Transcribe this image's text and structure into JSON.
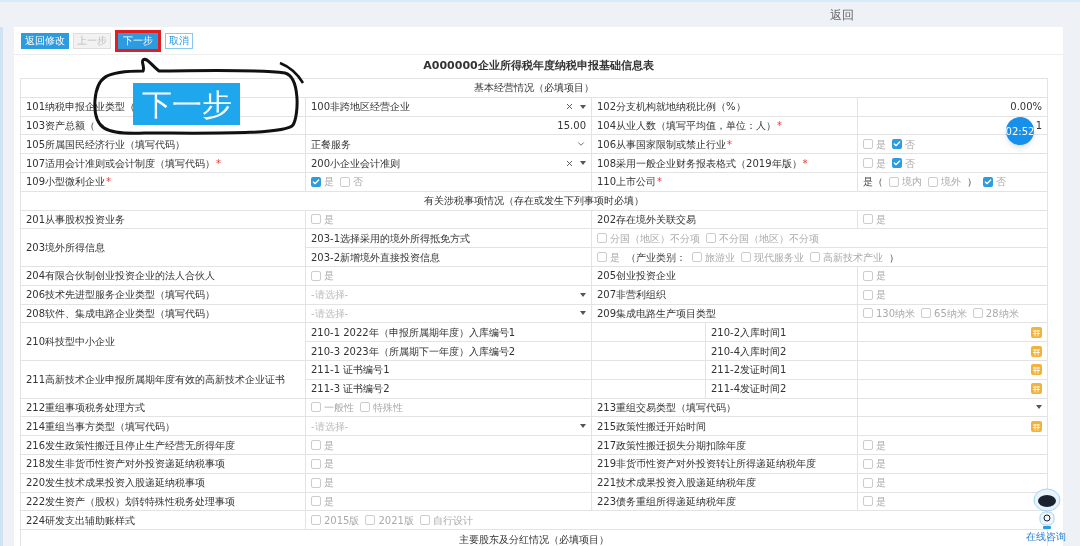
{
  "top_bar": {
    "link": "返回"
  },
  "toolbar": {
    "buttons": [
      {
        "label": "返回修改",
        "kind": "primary",
        "highlighted": false
      },
      {
        "label": "上一步",
        "kind": "disabled",
        "highlighted": false
      },
      {
        "label": "下一步",
        "kind": "primary",
        "highlighted": true
      },
      {
        "label": "取消",
        "kind": "outline",
        "highlighted": false
      }
    ]
  },
  "callout": {
    "text": "下一步"
  },
  "form": {
    "title": "A000000企业所得税年度纳税申报基础信息表",
    "sections": [
      {
        "title": "基本经营情况（必填项目）",
        "rows": [
          {
            "kind": "pair",
            "label": "101纳税申报企业类型（",
            "value": {
              "kind": "select",
              "value": "100非跨地区经营企业",
              "clearable": true
            },
            "right_label": "102分支机构就地纳税比例（%）",
            "right_value": {
              "kind": "number",
              "value": "0.00%"
            }
          },
          {
            "kind": "pair",
            "label": "103资产总额（",
            "value": {
              "kind": "number",
              "value": "15.00"
            },
            "right_label": "104从业人数（填写平均值，单位：人）",
            "right_mark": "*",
            "right_value": {
              "kind": "number",
              "value": "1"
            }
          },
          {
            "kind": "pair",
            "label": "105所属国民经济行业（填写代码）",
            "value": {
              "kind": "select",
              "value": "正餐服务",
              "clearable": false,
              "chevron": true
            },
            "right_label": "106从事国家限制或禁止行业",
            "right_mark": "*",
            "right_value": {
              "kind": "checks",
              "items": [
                {
                  "kind": "check",
                  "label": "是",
                  "checked": false
                },
                {
                  "kind": "check",
                  "label": "否",
                  "checked": true
                }
              ]
            }
          },
          {
            "kind": "pair",
            "label": "107适用会计准则或会计制度（填写代码）",
            "mark": "*",
            "value": {
              "kind": "select",
              "value": "200小企业会计准则",
              "clearable": true
            },
            "right_label": "108采用一般企业财务报表格式（2019年版）",
            "right_mark": "*",
            "right_value": {
              "kind": "checks",
              "items": [
                {
                  "kind": "check",
                  "label": "是",
                  "checked": false
                },
                {
                  "kind": "check",
                  "label": "否",
                  "checked": true
                }
              ]
            }
          },
          {
            "kind": "pair",
            "label": "109小型微利企业",
            "mark": "*",
            "value": {
              "kind": "checks",
              "items": [
                {
                  "kind": "check",
                  "label": "是",
                  "checked": true
                },
                {
                  "kind": "check",
                  "label": "否",
                  "checked": false
                }
              ]
            },
            "right_label": "110上市公司",
            "right_mark": "*",
            "right_value": {
              "kind": "checks",
              "items": [
                {
                  "kind": "text",
                  "text": "是（"
                },
                {
                  "kind": "check",
                  "label": "境内",
                  "checked": false
                },
                {
                  "kind": "check",
                  "label": "境外",
                  "checked": false
                },
                {
                  "kind": "text",
                  "text": "）"
                },
                {
                  "kind": "check",
                  "label": "否",
                  "checked": true
                }
              ]
            }
          }
        ]
      },
      {
        "title": "有关涉税事项情况（存在或发生下列事项时必填）",
        "rows": [
          {
            "kind": "pair",
            "label": "201从事股权投资业务",
            "value": {
              "kind": "checks",
              "items": [
                {
                  "kind": "check",
                  "label": "是",
                  "checked": false
                }
              ]
            },
            "right_label": "202存在境外关联交易",
            "right_value": {
              "kind": "checks",
              "items": [
                {
                  "kind": "check",
                  "label": "是",
                  "checked": false
                }
              ]
            }
          },
          {
            "kind": "group",
            "label": "203境外所得信息",
            "subrows": [
              {
                "label": "203-1选择采用的境外所得抵免方式",
                "value": {
                  "kind": "checks",
                  "items": [
                    {
                      "kind": "check",
                      "label": "分国（地区）不分项",
                      "checked": false
                    },
                    {
                      "kind": "check",
                      "label": "不分国（地区）不分项",
                      "checked": false
                    }
                  ]
                }
              },
              {
                "label": "203-2新增境外直接投资信息",
                "value": {
                  "kind": "checks",
                  "items": [
                    {
                      "kind": "check",
                      "label": "是",
                      "checked": false
                    },
                    {
                      "kind": "text",
                      "text": "（产业类别："
                    },
                    {
                      "kind": "check",
                      "label": "旅游业",
                      "checked": false
                    },
                    {
                      "kind": "check",
                      "label": "现代服务业",
                      "checked": false
                    },
                    {
                      "kind": "check",
                      "label": "高新技术产业",
                      "checked": false
                    },
                    {
                      "kind": "text",
                      "text": "）"
                    }
                  ]
                }
              }
            ]
          },
          {
            "kind": "pair",
            "label": "204有限合伙制创业投资企业的法人合伙人",
            "value": {
              "kind": "checks",
              "items": [
                {
                  "kind": "check",
                  "label": "是",
                  "checked": false
                }
              ]
            },
            "right_label": "205创业投资企业",
            "right_value": {
              "kind": "checks",
              "items": [
                {
                  "kind": "check",
                  "label": "是",
                  "checked": false
                }
              ]
            }
          },
          {
            "kind": "pair",
            "label": "206技术先进型服务企业类型（填写代码）",
            "value": {
              "kind": "select",
              "placeholder": "-请选择-",
              "clearable": false
            },
            "right_label": "207非营利组织",
            "right_value": {
              "kind": "checks",
              "items": [
                {
                  "kind": "check",
                  "label": "是",
                  "checked": false
                }
              ]
            }
          },
          {
            "kind": "pair",
            "label": "208软件、集成电路企业类型（填写代码）",
            "value": {
              "kind": "select",
              "placeholder": "-请选择-",
              "clearable": false
            },
            "right_label": "209集成电路生产项目类型",
            "right_value": {
              "kind": "checks",
              "items": [
                {
                  "kind": "check",
                  "label": "130纳米",
                  "checked": false
                },
                {
                  "kind": "check",
                  "label": "65纳米",
                  "checked": false
                },
                {
                  "kind": "check",
                  "label": "28纳米",
                  "checked": false
                }
              ]
            }
          },
          {
            "kind": "group",
            "label": "210科技型中小企业",
            "subrows": [
              {
                "label": "210-1 2022年（申报所属期年度）入库编号1",
                "right_label": "210-2入库时间1",
                "right_value": {
                  "kind": "date"
                }
              },
              {
                "label": "210-3 2023年（所属期下一年度）入库编号2",
                "right_label": "210-4入库时间2",
                "right_value": {
                  "kind": "date"
                }
              }
            ]
          },
          {
            "kind": "group",
            "label": "211高新技术企业申报所属期年度有效的高新技术企业证书",
            "subrows": [
              {
                "label": "211-1 证书编号1",
                "right_label": "211-2发证时间1",
                "right_value": {
                  "kind": "date"
                }
              },
              {
                "label": "211-3 证书编号2",
                "right_label": "211-4发证时间2",
                "right_value": {
                  "kind": "date"
                }
              }
            ]
          },
          {
            "kind": "pair",
            "label": "212重组事项税务处理方式",
            "value": {
              "kind": "checks",
              "items": [
                {
                  "kind": "check",
                  "label": "一般性",
                  "checked": false
                },
                {
                  "kind": "check",
                  "label": "特殊性",
                  "checked": false
                }
              ]
            },
            "right_label": "213重组交易类型（填写代码）",
            "right_value": {
              "kind": "select",
              "clearable": false
            }
          },
          {
            "kind": "pair",
            "label": "214重组当事方类型（填写代码）",
            "value": {
              "kind": "select",
              "placeholder": "-请选择-",
              "clearable": false
            },
            "right_label": "215政策性搬迁开始时间",
            "right_value": {
              "kind": "date"
            }
          },
          {
            "kind": "pair",
            "label": "216发生政策性搬迁且停止生产经营无所得年度",
            "value": {
              "kind": "checks",
              "items": [
                {
                  "kind": "check",
                  "label": "是",
                  "checked": false
                }
              ]
            },
            "right_label": "217政策性搬迁损失分期扣除年度",
            "right_value": {
              "kind": "checks",
              "items": [
                {
                  "kind": "check",
                  "label": "是",
                  "checked": false
                }
              ]
            }
          },
          {
            "kind": "pair",
            "label": "218发生非货币性资产对外投资递延纳税事项",
            "value": {
              "kind": "checks",
              "items": [
                {
                  "kind": "check",
                  "label": "是",
                  "checked": false
                }
              ]
            },
            "right_label": "219非货币性资产对外投资转让所得递延纳税年度",
            "right_value": {
              "kind": "checks",
              "items": [
                {
                  "kind": "check",
                  "label": "是",
                  "checked": false
                }
              ]
            }
          },
          {
            "kind": "pair",
            "label": "220发生技术成果投资入股递延纳税事项",
            "value": {
              "kind": "checks",
              "items": [
                {
                  "kind": "check",
                  "label": "是",
                  "checked": false
                }
              ]
            },
            "right_label": "221技术成果投资入股递延纳税年度",
            "right_value": {
              "kind": "checks",
              "items": [
                {
                  "kind": "check",
                  "label": "是",
                  "checked": false
                }
              ]
            }
          },
          {
            "kind": "pair",
            "label": "222发生资产（股权）划转特殊性税务处理事项",
            "value": {
              "kind": "checks",
              "items": [
                {
                  "kind": "check",
                  "label": "是",
                  "checked": false
                }
              ]
            },
            "right_label": "223债务重组所得递延纳税年度",
            "right_value": {
              "kind": "checks",
              "items": [
                {
                  "kind": "check",
                  "label": "是",
                  "checked": false
                }
              ]
            }
          },
          {
            "kind": "wide",
            "label": "224研发支出辅助账样式",
            "value": {
              "kind": "checks",
              "items": [
                {
                  "kind": "check",
                  "label": "2015版",
                  "checked": false
                },
                {
                  "kind": "check",
                  "label": "2021版",
                  "checked": false
                },
                {
                  "kind": "check",
                  "label": "自行设计",
                  "checked": false
                }
              ]
            }
          }
        ]
      },
      {
        "title": "主要股东及分红情况（必填项目）"
      }
    ]
  },
  "timer": {
    "text": "02:52"
  },
  "assistant": {
    "label": "在线咨询"
  }
}
